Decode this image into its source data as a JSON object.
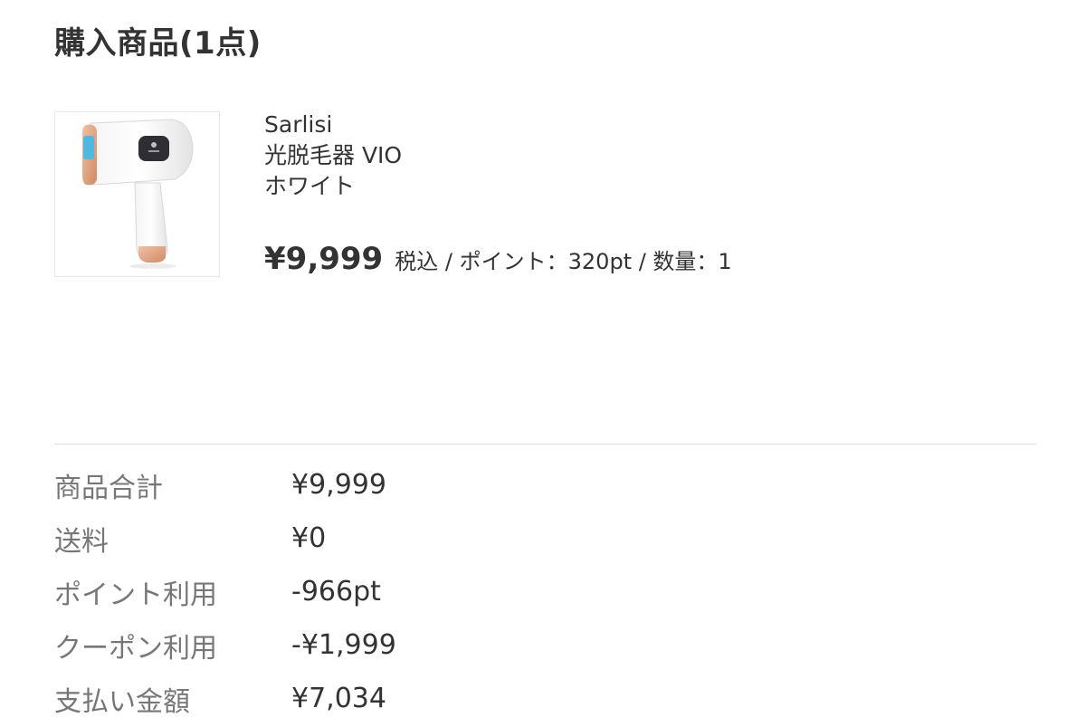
{
  "header": {
    "title": "購入商品(1点)"
  },
  "product": {
    "brand": "Sarlisi",
    "name": "光脱毛器 VIO",
    "color": "ホワイト",
    "price": "¥9,999",
    "price_meta": "税込 / ポイント：320pt / 数量：1"
  },
  "summary": {
    "rows": [
      {
        "label": "商品合計",
        "value": "¥9,999"
      },
      {
        "label": "送料",
        "value": "¥0"
      },
      {
        "label": "ポイント利用",
        "value": "-966pt"
      },
      {
        "label": "クーポン利用",
        "value": "-¥1,999"
      },
      {
        "label": "支払い金額",
        "value": "¥7,034"
      }
    ]
  },
  "colors": {
    "text_primary": "#333333",
    "text_secondary": "#777777",
    "divider": "#dddddd",
    "device_accent": "#e3a27e",
    "device_window": "#4fb7e0"
  }
}
